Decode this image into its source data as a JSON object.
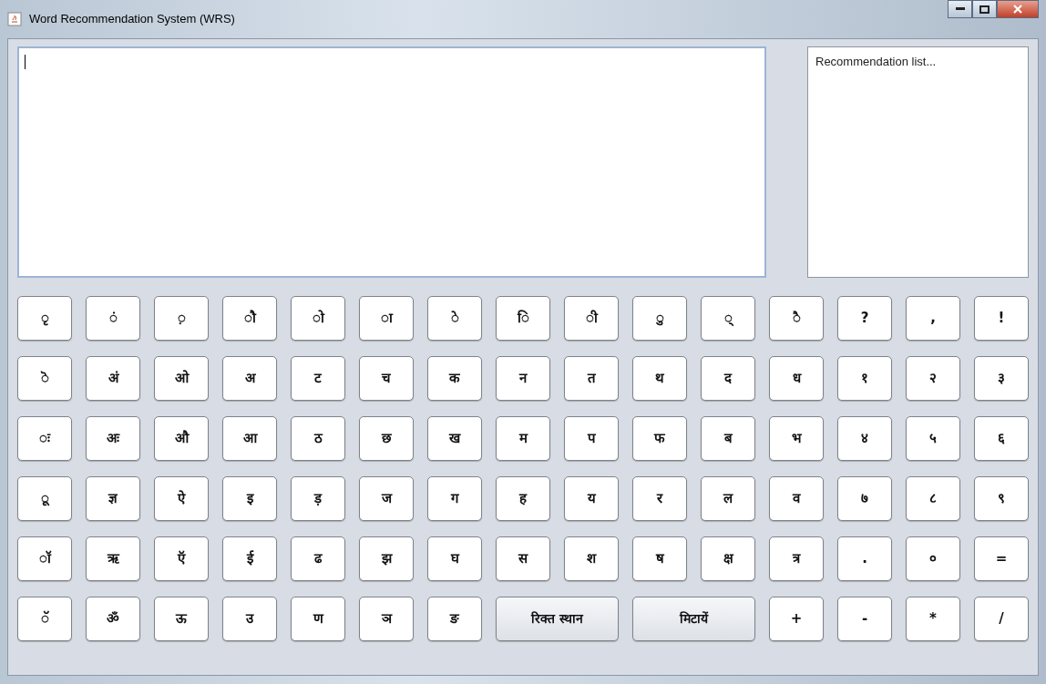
{
  "window": {
    "title": "Word Recommendation System (WRS)"
  },
  "recommendation_list": {
    "placeholder": "Recommendation list..."
  },
  "keyboard": [
    [
      {
        "label": "◌ृ",
        "kind": "char"
      },
      {
        "label": "◌ं",
        "kind": "char"
      },
      {
        "label": "◌़",
        "kind": "char"
      },
      {
        "label": "◌ौ",
        "kind": "char"
      },
      {
        "label": "◌ो",
        "kind": "char"
      },
      {
        "label": "◌ा",
        "kind": "char"
      },
      {
        "label": "◌े",
        "kind": "char"
      },
      {
        "label": "◌ि",
        "kind": "char"
      },
      {
        "label": "◌ी",
        "kind": "char"
      },
      {
        "label": "◌ु",
        "kind": "char"
      },
      {
        "label": "◌्",
        "kind": "char"
      },
      {
        "label": "◌ै",
        "kind": "char"
      },
      {
        "label": "?",
        "kind": "char"
      },
      {
        "label": ",",
        "kind": "char"
      },
      {
        "label": "!",
        "kind": "char"
      }
    ],
    [
      {
        "label": "◌ॆ",
        "kind": "char"
      },
      {
        "label": "अं",
        "kind": "char"
      },
      {
        "label": "ओ",
        "kind": "char"
      },
      {
        "label": "अ",
        "kind": "char"
      },
      {
        "label": "ट",
        "kind": "char"
      },
      {
        "label": "च",
        "kind": "char"
      },
      {
        "label": "क",
        "kind": "char"
      },
      {
        "label": "न",
        "kind": "char"
      },
      {
        "label": "त",
        "kind": "char"
      },
      {
        "label": "थ",
        "kind": "char"
      },
      {
        "label": "द",
        "kind": "char"
      },
      {
        "label": "ध",
        "kind": "char"
      },
      {
        "label": "१",
        "kind": "char"
      },
      {
        "label": "२",
        "kind": "char"
      },
      {
        "label": "३",
        "kind": "char"
      }
    ],
    [
      {
        "label": "◌ः",
        "kind": "char"
      },
      {
        "label": "अः",
        "kind": "char"
      },
      {
        "label": "औ",
        "kind": "char"
      },
      {
        "label": "आ",
        "kind": "char"
      },
      {
        "label": "ठ",
        "kind": "char"
      },
      {
        "label": "छ",
        "kind": "char"
      },
      {
        "label": "ख",
        "kind": "char"
      },
      {
        "label": "म",
        "kind": "char"
      },
      {
        "label": "प",
        "kind": "char"
      },
      {
        "label": "फ",
        "kind": "char"
      },
      {
        "label": "ब",
        "kind": "char"
      },
      {
        "label": "भ",
        "kind": "char"
      },
      {
        "label": "४",
        "kind": "char"
      },
      {
        "label": "५",
        "kind": "char"
      },
      {
        "label": "६",
        "kind": "char"
      }
    ],
    [
      {
        "label": "◌ू",
        "kind": "char"
      },
      {
        "label": "ज्ञ",
        "kind": "char"
      },
      {
        "label": "ऐ",
        "kind": "char"
      },
      {
        "label": "इ",
        "kind": "char"
      },
      {
        "label": "ड़",
        "kind": "char"
      },
      {
        "label": "ज",
        "kind": "char"
      },
      {
        "label": "ग",
        "kind": "char"
      },
      {
        "label": "ह",
        "kind": "char"
      },
      {
        "label": "य",
        "kind": "char"
      },
      {
        "label": "र",
        "kind": "char"
      },
      {
        "label": "ल",
        "kind": "char"
      },
      {
        "label": "व",
        "kind": "char"
      },
      {
        "label": "७",
        "kind": "char"
      },
      {
        "label": "८",
        "kind": "char"
      },
      {
        "label": "९",
        "kind": "char"
      }
    ],
    [
      {
        "label": "◌ॉ",
        "kind": "char"
      },
      {
        "label": "ऋ",
        "kind": "char"
      },
      {
        "label": "ऍ",
        "kind": "char"
      },
      {
        "label": "ई",
        "kind": "char"
      },
      {
        "label": "ढ",
        "kind": "char"
      },
      {
        "label": "झ",
        "kind": "char"
      },
      {
        "label": "घ",
        "kind": "char"
      },
      {
        "label": "स",
        "kind": "char"
      },
      {
        "label": "श",
        "kind": "char"
      },
      {
        "label": "ष",
        "kind": "char"
      },
      {
        "label": "क्ष",
        "kind": "char"
      },
      {
        "label": "त्र",
        "kind": "char"
      },
      {
        "label": ".",
        "kind": "char"
      },
      {
        "label": "०",
        "kind": "char"
      },
      {
        "label": "=",
        "kind": "char"
      }
    ],
    [
      {
        "label": "◌ॅ",
        "kind": "char"
      },
      {
        "label": "ॐ",
        "kind": "char"
      },
      {
        "label": "ऊ",
        "kind": "char"
      },
      {
        "label": "उ",
        "kind": "char"
      },
      {
        "label": "ण",
        "kind": "char"
      },
      {
        "label": "ञ",
        "kind": "char"
      },
      {
        "label": "ङ",
        "kind": "char"
      },
      {
        "label": "रिक्त स्थान",
        "kind": "wide"
      },
      {
        "label": "मिटायें",
        "kind": "wide"
      },
      {
        "label": "+",
        "kind": "char"
      },
      {
        "label": "-",
        "kind": "char"
      },
      {
        "label": "*",
        "kind": "char"
      },
      {
        "label": "/",
        "kind": "char"
      }
    ]
  ]
}
